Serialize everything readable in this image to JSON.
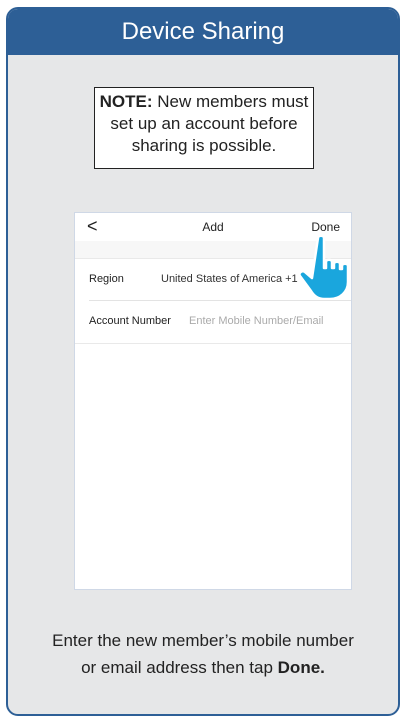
{
  "header": {
    "title": "Device Sharing"
  },
  "note": {
    "label": "NOTE:",
    "text_line1": "New members must",
    "text_line2": "set up an account before",
    "text_line3": "sharing is possible."
  },
  "phone": {
    "back_icon": "chevron-left-icon",
    "back_glyph": "<",
    "title": "Add",
    "done_label": "Done",
    "form": {
      "region_label": "Region",
      "region_value": "United States of America +1",
      "account_label": "Account Number",
      "account_placeholder": "Enter Mobile Number/Email"
    }
  },
  "caption": {
    "line1": "Enter the new member’s mobile number",
    "line2_prefix": "or email address then tap ",
    "line2_emphasis": "Done."
  },
  "colors": {
    "accent": "#2d5f96",
    "panel": "#e6e7e8",
    "hand": "#1aa6dd"
  },
  "icons": {
    "tap": "pointing-hand-icon"
  }
}
